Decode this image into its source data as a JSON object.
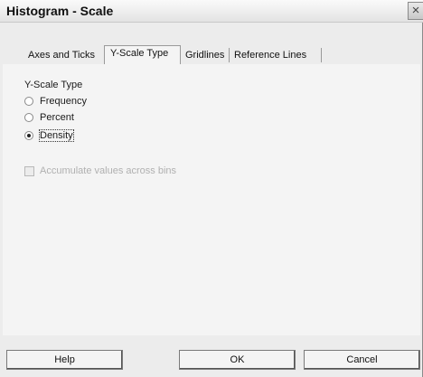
{
  "window": {
    "title": "Histogram - Scale",
    "close_glyph": "×"
  },
  "tabs": [
    {
      "label": "Axes and Ticks",
      "active": false
    },
    {
      "label": "Y-Scale Type",
      "active": true
    },
    {
      "label": "Gridlines",
      "active": false
    },
    {
      "label": "Reference Lines",
      "active": false
    }
  ],
  "yscale": {
    "group_label": "Y-Scale Type",
    "options": [
      {
        "label": "Frequency",
        "checked": false
      },
      {
        "label": "Percent",
        "checked": false
      },
      {
        "label": "Density",
        "checked": true
      }
    ],
    "accumulate_label": "Accumulate values across bins",
    "accumulate_enabled": false,
    "accumulate_checked": false
  },
  "buttons": {
    "help": "Help",
    "ok": "OK",
    "cancel": "Cancel"
  }
}
